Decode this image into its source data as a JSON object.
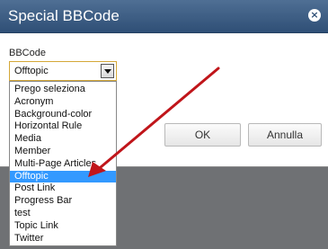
{
  "dialog": {
    "title": "Special BBCode",
    "close_icon": "close-icon",
    "field_label": "BBCode",
    "selected_value": "Offtopic",
    "ok_label": "OK",
    "cancel_label": "Annulla"
  },
  "dropdown": {
    "options": [
      "Prego seleziona",
      "Acronym",
      "Background-color",
      "Horizontal Rule",
      "Media",
      "Member",
      "Multi-Page Articles",
      "Offtopic",
      "Post Link",
      "Progress Bar",
      "test",
      "Topic Link",
      "Twitter"
    ],
    "selected_index": 7
  },
  "colors": {
    "titlebar": "#2f4f76",
    "selection": "#3399ff",
    "annotation_arrow": "#c0151a"
  }
}
